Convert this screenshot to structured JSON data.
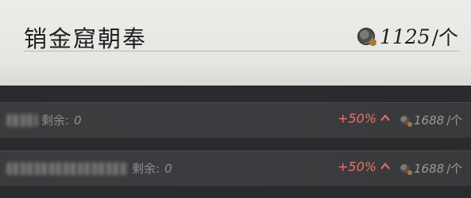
{
  "header": {
    "title": "销金窟朝奉",
    "price": "1125",
    "unit": "/个",
    "coin_icon": "coin-icon"
  },
  "listings": [
    {
      "seller": "██████",
      "remain_label": "剩余:",
      "remain_value": "0",
      "change": "+50%",
      "price": "1688",
      "unit": "/个"
    },
    {
      "seller": "████████████",
      "remain_label": "剩余:",
      "remain_value": "0",
      "change": "+50%",
      "price": "1688",
      "unit": "/个"
    }
  ],
  "colors": {
    "accent_up": "#e6736b",
    "header_bg": "#ececea",
    "row_bg": "#3a3b3d"
  }
}
